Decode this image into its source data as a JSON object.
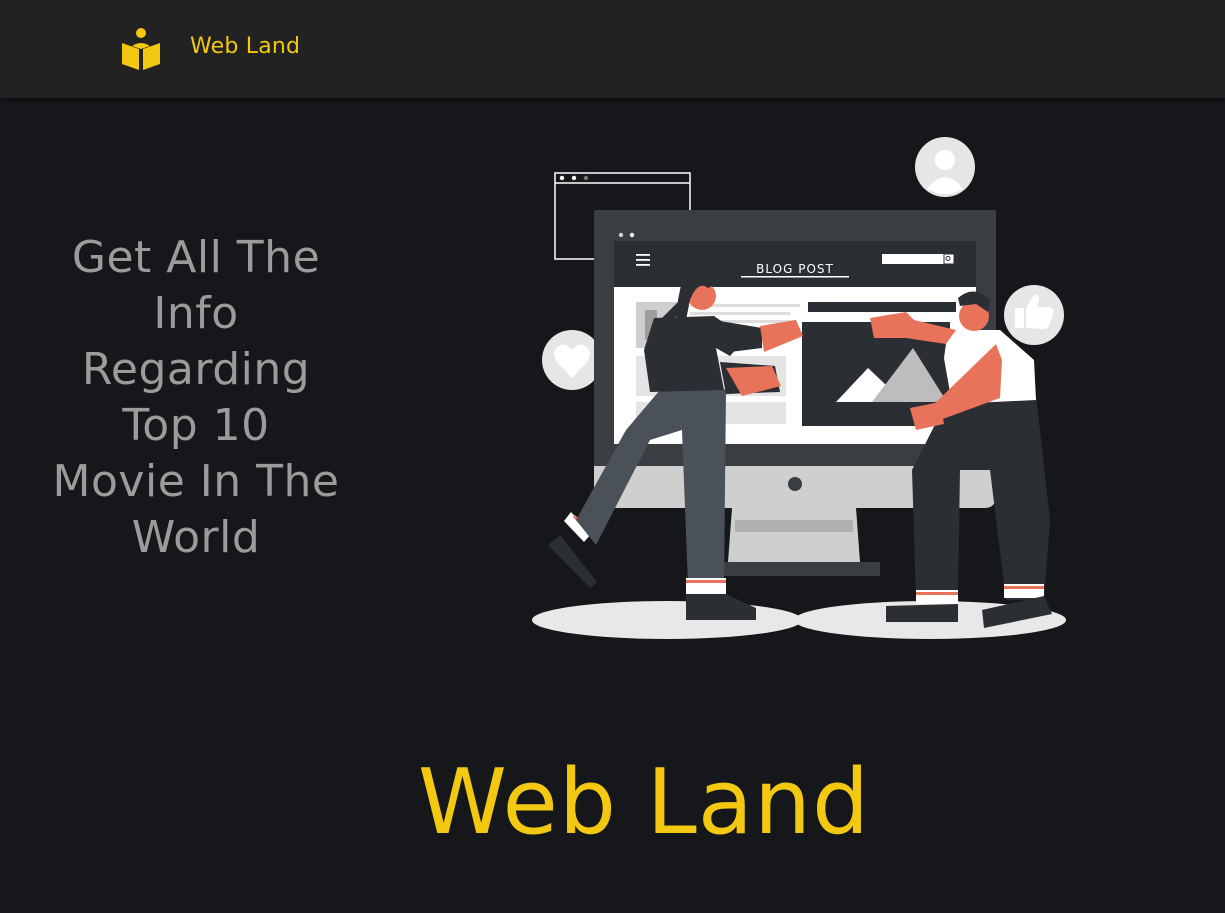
{
  "navbar": {
    "logo_icon": "open-book-reader-icon",
    "brand_name": "Web Land"
  },
  "hero": {
    "headline": "Get All The Info Regarding Top 10 Movie In The World",
    "illustration": {
      "caption": "BLOG POST",
      "icons": [
        "user-avatar-icon",
        "heart-icon",
        "thumbs-up-icon",
        "search-icon",
        "menu-icon",
        "image-icon"
      ]
    }
  },
  "footer_title": "Web Land",
  "colors": {
    "background": "#16171b",
    "navbar": "#222222",
    "accent": "#f2c811",
    "hero_text": "#9b9b9b",
    "illustration_accent": "#e8735a"
  }
}
